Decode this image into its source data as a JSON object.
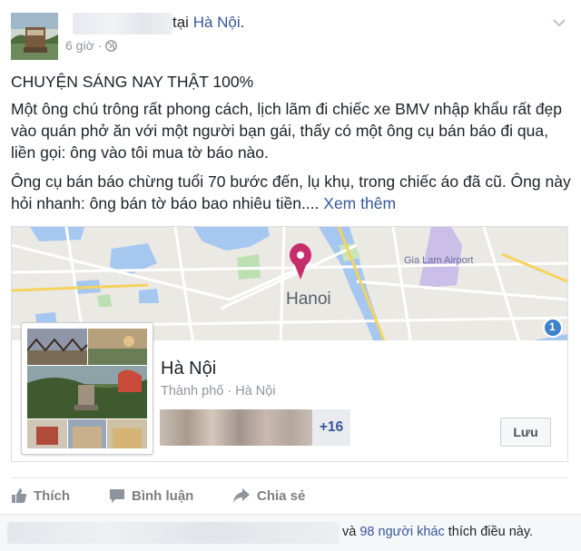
{
  "header": {
    "author_name": "",
    "location_prefix": "tại",
    "location": "Hà Nội",
    "location_suffix": ".",
    "time": "6 giờ",
    "separator": "·",
    "privacy_icon": "globe-icon",
    "menu_icon": "chevron-down-icon"
  },
  "body": {
    "title": "CHUYỆN SÁNG NAY THẬT 100%",
    "paragraph1": "Một ông chú trông rất phong cách, lịch lãm đi chiếc xe BMV nhập khẩu rất đẹp vào quán phở ăn với một người bạn gái, thấy có một ông cụ bán báo đi qua, liền gọi: ông vào tôi mua tờ báo nào.",
    "paragraph2": "Ông cụ bán báo chừng tuổi 70 bước đến, lụ khụ, trong chiếc áo đã cũ. Ông này hỏi nhanh: ông bán tờ báo bao nhiêu tiền....",
    "see_more": "Xem thêm"
  },
  "map_card": {
    "map_city_label": "Hanoi",
    "map_airport_label": "Gia Lam Airport",
    "map_route_badge": "1",
    "place_name": "Hà Nội",
    "place_subtitle": "Thành phố · Hà Nội",
    "friends_more": "+16",
    "save_label": "Lưu",
    "pin_color": "#c62e6b"
  },
  "actions": {
    "like": "Thích",
    "comment": "Bình luận",
    "share": "Chia sẻ"
  },
  "likes_summary": {
    "prefix": "và",
    "others_link": "98 người khác",
    "suffix": "thích điều này."
  },
  "colors": {
    "link": "#365899",
    "muted": "#90949c",
    "text": "#1d2129",
    "water": "#a6c7f0"
  }
}
